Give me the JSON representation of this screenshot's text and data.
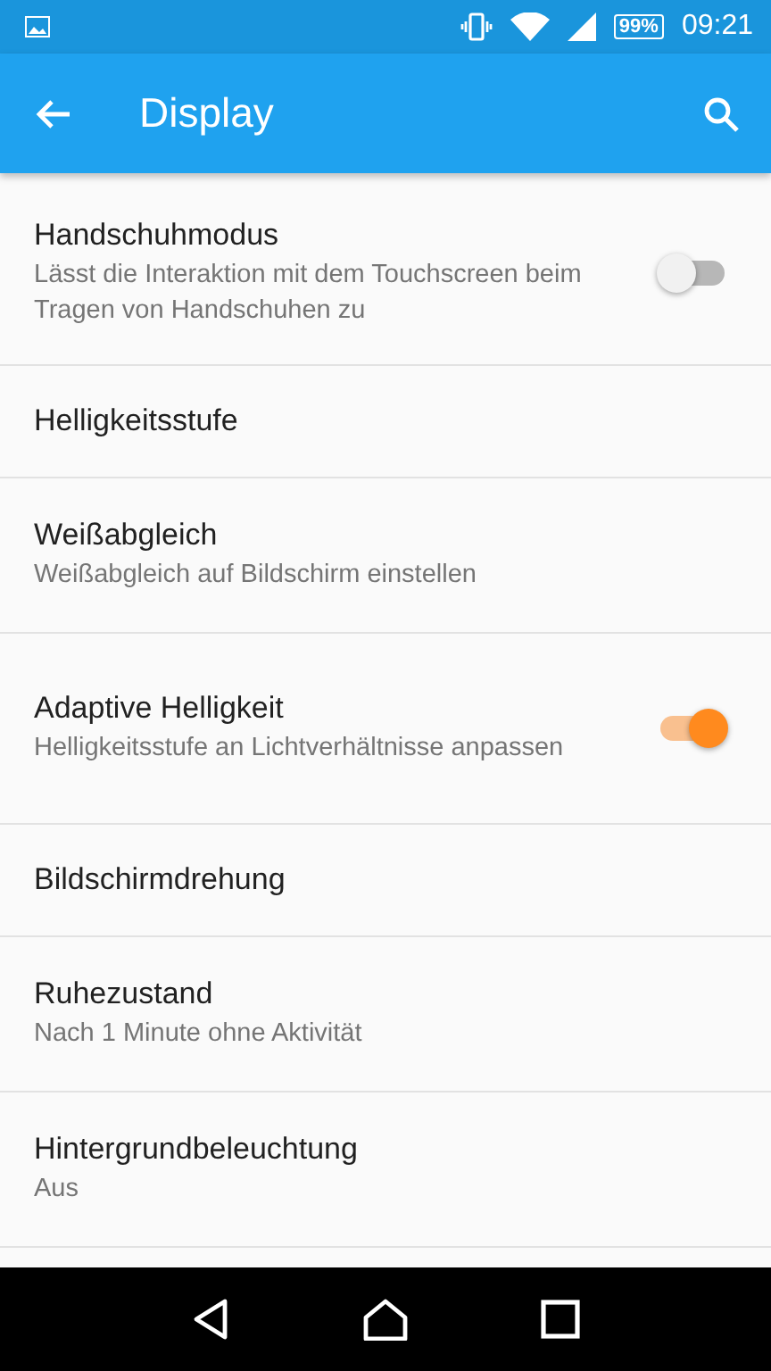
{
  "status_bar": {
    "battery": "99%",
    "time": "09:21"
  },
  "app_bar": {
    "title": "Display"
  },
  "settings": [
    {
      "kind": "switch",
      "title": "Handschuhmodus",
      "summary": "Lässt die Interaktion mit dem Touchscreen beim Tragen von Handschuhen zu",
      "on": false
    },
    {
      "kind": "plain",
      "title": "Helligkeitsstufe"
    },
    {
      "kind": "plain",
      "title": "Weißabgleich",
      "summary": "Weißabgleich auf Bildschirm einstellen"
    },
    {
      "kind": "switch",
      "title": "Adaptive Helligkeit",
      "summary": "Helligkeitsstufe an Lichtverhältnisse anpassen",
      "on": true
    },
    {
      "kind": "plain",
      "title": "Bildschirmdrehung"
    },
    {
      "kind": "plain",
      "title": "Ruhezustand",
      "summary": "Nach 1 Minute ohne Aktivität"
    },
    {
      "kind": "plain",
      "title": "Hintergrundbeleuchtung",
      "summary": "Aus"
    }
  ]
}
